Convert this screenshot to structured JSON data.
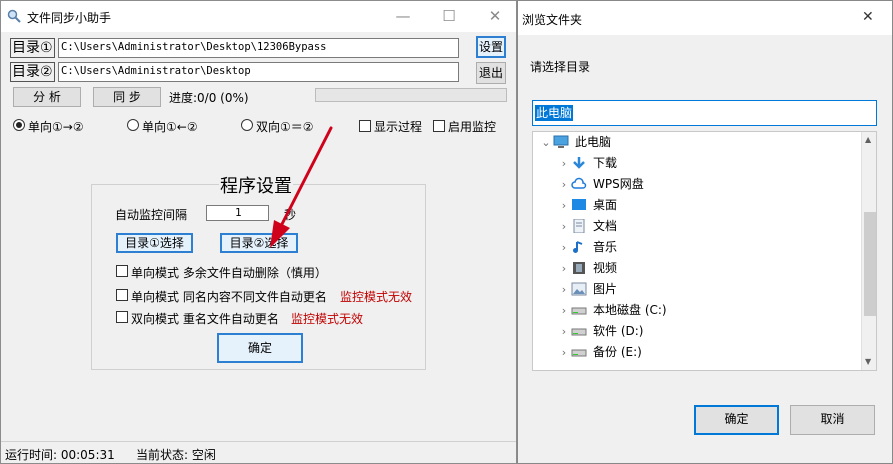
{
  "main": {
    "title": "文件同步小助手",
    "dir1_label": "目录①",
    "dir1_path": "C:\\Users\\Administrator\\Desktop\\12306Bypass",
    "dir2_label": "目录②",
    "dir2_path": "C:\\Users\\Administrator\\Desktop",
    "settings_button": "设置",
    "exit_button": "退出",
    "analyze_button": "分 析",
    "sync_button": "同 步",
    "progress_text": "进度:0/0 (0%)",
    "progress_fraction": 0,
    "modes": [
      {
        "label": "单向①→②",
        "selected": true
      },
      {
        "label": "单向①←②",
        "selected": false
      },
      {
        "label": "双向①＝②",
        "selected": false
      }
    ],
    "show_process_label": "显示过程",
    "enable_monitor_label": "启用监控"
  },
  "settings": {
    "title": "程序设置",
    "interval_label": "自动监控间隔",
    "interval_value": "1",
    "interval_unit": "秒",
    "dir1_select_button": "目录①选择",
    "dir2_select_button": "目录②选择",
    "options": [
      {
        "label": "单向模式 多余文件自动删除（慎用）",
        "note": ""
      },
      {
        "label": "单向模式 同名内容不同文件自动更名",
        "note": "监控模式无效"
      },
      {
        "label": "双向模式 重名文件自动更名",
        "note": "监控模式无效"
      }
    ],
    "ok_button": "确定"
  },
  "status": {
    "run_time": "运行时间: 00:05:31",
    "current_state": "当前状态: 空闲"
  },
  "dialog": {
    "title": "浏览文件夹",
    "close_glyph": "✕",
    "prompt": "请选择目录",
    "folder_value": "此电脑",
    "tree": [
      {
        "label": "此电脑",
        "icon": "computer-icon",
        "level": 0,
        "expanded": true
      },
      {
        "label": "下载",
        "icon": "download-icon",
        "level": 1
      },
      {
        "label": "WPS网盘",
        "icon": "cloud-icon",
        "level": 1
      },
      {
        "label": "桌面",
        "icon": "desktop-icon",
        "level": 1
      },
      {
        "label": "文档",
        "icon": "document-icon",
        "level": 1
      },
      {
        "label": "音乐",
        "icon": "music-icon",
        "level": 1
      },
      {
        "label": "视频",
        "icon": "video-icon",
        "level": 1
      },
      {
        "label": "图片",
        "icon": "picture-icon",
        "level": 1
      },
      {
        "label": "本地磁盘 (C:)",
        "icon": "drive-icon",
        "level": 1
      },
      {
        "label": "软件 (D:)",
        "icon": "drive-icon",
        "level": 1
      },
      {
        "label": "备份 (E:)",
        "icon": "drive-icon",
        "level": 1
      }
    ],
    "ok_button": "确定",
    "cancel_button": "取消"
  },
  "colors": {
    "accent_blue": "#0078d7",
    "arrow_red": "#d0021b",
    "warning_red": "#c00000"
  }
}
